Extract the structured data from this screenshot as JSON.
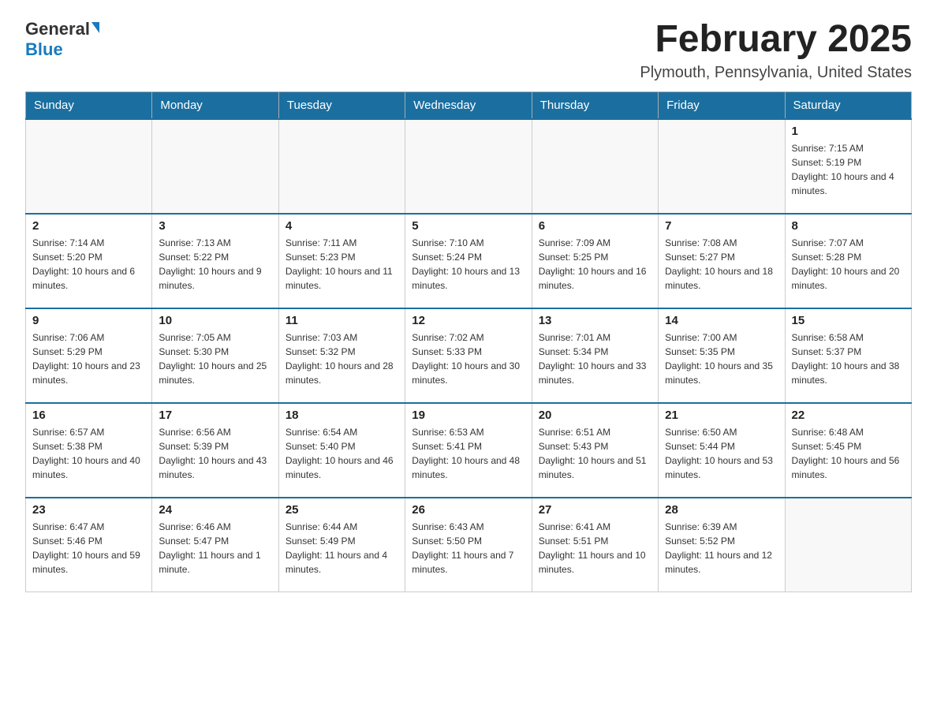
{
  "logo": {
    "general": "General",
    "blue": "Blue",
    "arrow": "▶"
  },
  "title": "February 2025",
  "location": "Plymouth, Pennsylvania, United States",
  "days_header": [
    "Sunday",
    "Monday",
    "Tuesday",
    "Wednesday",
    "Thursday",
    "Friday",
    "Saturday"
  ],
  "weeks": [
    [
      {
        "day": "",
        "sunrise": "",
        "sunset": "",
        "daylight": "",
        "empty": true
      },
      {
        "day": "",
        "sunrise": "",
        "sunset": "",
        "daylight": "",
        "empty": true
      },
      {
        "day": "",
        "sunrise": "",
        "sunset": "",
        "daylight": "",
        "empty": true
      },
      {
        "day": "",
        "sunrise": "",
        "sunset": "",
        "daylight": "",
        "empty": true
      },
      {
        "day": "",
        "sunrise": "",
        "sunset": "",
        "daylight": "",
        "empty": true
      },
      {
        "day": "",
        "sunrise": "",
        "sunset": "",
        "daylight": "",
        "empty": true
      },
      {
        "day": "1",
        "sunrise": "Sunrise: 7:15 AM",
        "sunset": "Sunset: 5:19 PM",
        "daylight": "Daylight: 10 hours and 4 minutes.",
        "empty": false
      }
    ],
    [
      {
        "day": "2",
        "sunrise": "Sunrise: 7:14 AM",
        "sunset": "Sunset: 5:20 PM",
        "daylight": "Daylight: 10 hours and 6 minutes.",
        "empty": false
      },
      {
        "day": "3",
        "sunrise": "Sunrise: 7:13 AM",
        "sunset": "Sunset: 5:22 PM",
        "daylight": "Daylight: 10 hours and 9 minutes.",
        "empty": false
      },
      {
        "day": "4",
        "sunrise": "Sunrise: 7:11 AM",
        "sunset": "Sunset: 5:23 PM",
        "daylight": "Daylight: 10 hours and 11 minutes.",
        "empty": false
      },
      {
        "day": "5",
        "sunrise": "Sunrise: 7:10 AM",
        "sunset": "Sunset: 5:24 PM",
        "daylight": "Daylight: 10 hours and 13 minutes.",
        "empty": false
      },
      {
        "day": "6",
        "sunrise": "Sunrise: 7:09 AM",
        "sunset": "Sunset: 5:25 PM",
        "daylight": "Daylight: 10 hours and 16 minutes.",
        "empty": false
      },
      {
        "day": "7",
        "sunrise": "Sunrise: 7:08 AM",
        "sunset": "Sunset: 5:27 PM",
        "daylight": "Daylight: 10 hours and 18 minutes.",
        "empty": false
      },
      {
        "day": "8",
        "sunrise": "Sunrise: 7:07 AM",
        "sunset": "Sunset: 5:28 PM",
        "daylight": "Daylight: 10 hours and 20 minutes.",
        "empty": false
      }
    ],
    [
      {
        "day": "9",
        "sunrise": "Sunrise: 7:06 AM",
        "sunset": "Sunset: 5:29 PM",
        "daylight": "Daylight: 10 hours and 23 minutes.",
        "empty": false
      },
      {
        "day": "10",
        "sunrise": "Sunrise: 7:05 AM",
        "sunset": "Sunset: 5:30 PM",
        "daylight": "Daylight: 10 hours and 25 minutes.",
        "empty": false
      },
      {
        "day": "11",
        "sunrise": "Sunrise: 7:03 AM",
        "sunset": "Sunset: 5:32 PM",
        "daylight": "Daylight: 10 hours and 28 minutes.",
        "empty": false
      },
      {
        "day": "12",
        "sunrise": "Sunrise: 7:02 AM",
        "sunset": "Sunset: 5:33 PM",
        "daylight": "Daylight: 10 hours and 30 minutes.",
        "empty": false
      },
      {
        "day": "13",
        "sunrise": "Sunrise: 7:01 AM",
        "sunset": "Sunset: 5:34 PM",
        "daylight": "Daylight: 10 hours and 33 minutes.",
        "empty": false
      },
      {
        "day": "14",
        "sunrise": "Sunrise: 7:00 AM",
        "sunset": "Sunset: 5:35 PM",
        "daylight": "Daylight: 10 hours and 35 minutes.",
        "empty": false
      },
      {
        "day": "15",
        "sunrise": "Sunrise: 6:58 AM",
        "sunset": "Sunset: 5:37 PM",
        "daylight": "Daylight: 10 hours and 38 minutes.",
        "empty": false
      }
    ],
    [
      {
        "day": "16",
        "sunrise": "Sunrise: 6:57 AM",
        "sunset": "Sunset: 5:38 PM",
        "daylight": "Daylight: 10 hours and 40 minutes.",
        "empty": false
      },
      {
        "day": "17",
        "sunrise": "Sunrise: 6:56 AM",
        "sunset": "Sunset: 5:39 PM",
        "daylight": "Daylight: 10 hours and 43 minutes.",
        "empty": false
      },
      {
        "day": "18",
        "sunrise": "Sunrise: 6:54 AM",
        "sunset": "Sunset: 5:40 PM",
        "daylight": "Daylight: 10 hours and 46 minutes.",
        "empty": false
      },
      {
        "day": "19",
        "sunrise": "Sunrise: 6:53 AM",
        "sunset": "Sunset: 5:41 PM",
        "daylight": "Daylight: 10 hours and 48 minutes.",
        "empty": false
      },
      {
        "day": "20",
        "sunrise": "Sunrise: 6:51 AM",
        "sunset": "Sunset: 5:43 PM",
        "daylight": "Daylight: 10 hours and 51 minutes.",
        "empty": false
      },
      {
        "day": "21",
        "sunrise": "Sunrise: 6:50 AM",
        "sunset": "Sunset: 5:44 PM",
        "daylight": "Daylight: 10 hours and 53 minutes.",
        "empty": false
      },
      {
        "day": "22",
        "sunrise": "Sunrise: 6:48 AM",
        "sunset": "Sunset: 5:45 PM",
        "daylight": "Daylight: 10 hours and 56 minutes.",
        "empty": false
      }
    ],
    [
      {
        "day": "23",
        "sunrise": "Sunrise: 6:47 AM",
        "sunset": "Sunset: 5:46 PM",
        "daylight": "Daylight: 10 hours and 59 minutes.",
        "empty": false
      },
      {
        "day": "24",
        "sunrise": "Sunrise: 6:46 AM",
        "sunset": "Sunset: 5:47 PM",
        "daylight": "Daylight: 11 hours and 1 minute.",
        "empty": false
      },
      {
        "day": "25",
        "sunrise": "Sunrise: 6:44 AM",
        "sunset": "Sunset: 5:49 PM",
        "daylight": "Daylight: 11 hours and 4 minutes.",
        "empty": false
      },
      {
        "day": "26",
        "sunrise": "Sunrise: 6:43 AM",
        "sunset": "Sunset: 5:50 PM",
        "daylight": "Daylight: 11 hours and 7 minutes.",
        "empty": false
      },
      {
        "day": "27",
        "sunrise": "Sunrise: 6:41 AM",
        "sunset": "Sunset: 5:51 PM",
        "daylight": "Daylight: 11 hours and 10 minutes.",
        "empty": false
      },
      {
        "day": "28",
        "sunrise": "Sunrise: 6:39 AM",
        "sunset": "Sunset: 5:52 PM",
        "daylight": "Daylight: 11 hours and 12 minutes.",
        "empty": false
      },
      {
        "day": "",
        "sunrise": "",
        "sunset": "",
        "daylight": "",
        "empty": true
      }
    ]
  ]
}
